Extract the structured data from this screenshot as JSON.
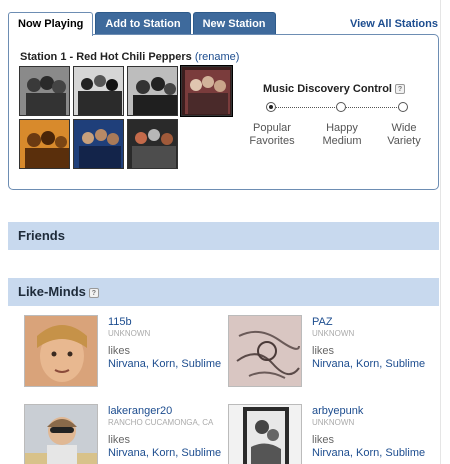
{
  "tabs": [
    "Now Playing",
    "Add to Station",
    "New Station"
  ],
  "view_all": "View All Stations",
  "station": {
    "title": "Station 1 - Red Hot Chili Peppers",
    "rename": "(rename)"
  },
  "discovery": {
    "title": "Music Discovery Control",
    "help": "?",
    "options": [
      {
        "line1": "Popular",
        "line2": "Favorites"
      },
      {
        "line1": "Happy",
        "line2": "Medium"
      },
      {
        "line1": "Wide",
        "line2": "Variety"
      }
    ],
    "selected": "Popular Favorites"
  },
  "sections": {
    "friends": "Friends",
    "like_minds": "Like-Minds",
    "like_minds_help": "?"
  },
  "users": [
    {
      "name": "115b",
      "location": "UNKNOWN",
      "likes": "likes",
      "bands": "Nirvana, Korn, Sublime"
    },
    {
      "name": "PAZ",
      "location": "UNKNOWN",
      "likes": "likes",
      "bands": "Nirvana, Korn, Sublime"
    },
    {
      "name": "lakeranger20",
      "location": "RANCHO CUCAMONGA, CA",
      "likes": "likes",
      "bands": "Nirvana, Korn, Sublime"
    },
    {
      "name": "arbyepunk",
      "location": "UNKNOWN",
      "likes": "likes",
      "bands": "Nirvana, Korn, Sublime"
    }
  ],
  "colors": {
    "tab_inactive": "#3e6a9c",
    "panel_border": "#6d8db3",
    "section_bar": "#c8d9ee",
    "link": "#1d4d8f"
  }
}
